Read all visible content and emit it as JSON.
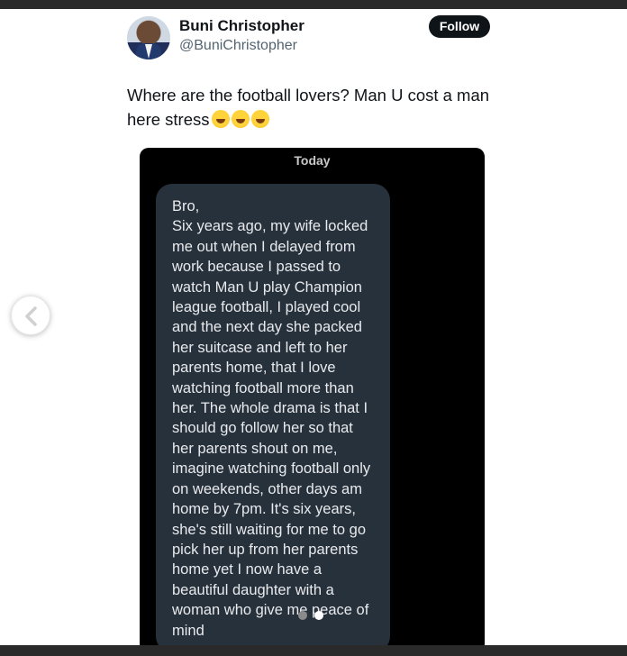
{
  "author": {
    "name": "Buni Christopher",
    "handle": "@BuniChristopher"
  },
  "follow_button": {
    "label": "Follow"
  },
  "tweet": {
    "text": "Where are the football lovers? Man U cost a man here stress",
    "emoji_count": 3,
    "emoji_icon": "rolling-on-the-floor-laughing-emoji"
  },
  "media": {
    "day_label": "Today",
    "message_greeting": "Bro,",
    "message_body": "Six years ago, my wife locked me out when I delayed from work because I passed to watch Man U play Champion league football, I played cool and the next day she packed her suitcase and left to her parents home, that I love watching football more than her. The whole drama is that I should go follow her so that her parents shout on me, imagine watching football only on weekends, other days am home by 7pm.  It's six years, she's still waiting for me to go pick her up from her parents home yet I now have a beautiful daughter with a woman who give me peace of mind",
    "page_dots": 2,
    "active_dot": 2
  },
  "navigation": {
    "prev_icon": "chevron-left-icon"
  },
  "colors": {
    "follow_bg": "#0f1419",
    "bubble_bg": "#27313b",
    "media_bg": "#000000"
  }
}
